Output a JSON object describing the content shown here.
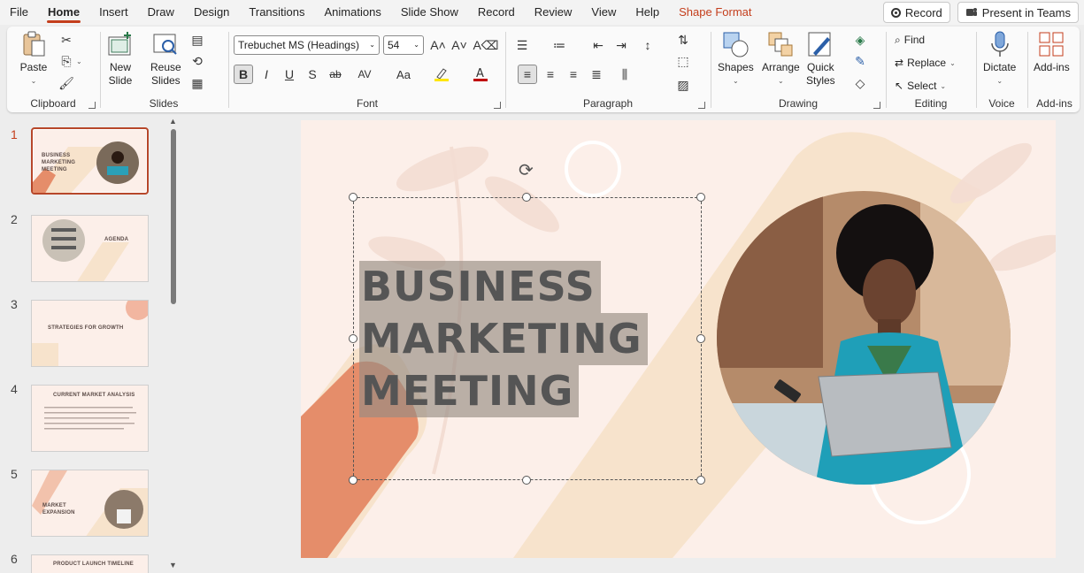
{
  "menu": {
    "items": [
      "File",
      "Home",
      "Insert",
      "Draw",
      "Design",
      "Transitions",
      "Animations",
      "Slide Show",
      "Record",
      "Review",
      "View",
      "Help",
      "Shape Format"
    ],
    "active": "Home",
    "record_label": "Record",
    "present_label": "Present in Teams"
  },
  "ribbon": {
    "clipboard": {
      "paste": "Paste",
      "label": "Clipboard"
    },
    "slides": {
      "new_slide_1": "New",
      "new_slide_2": "Slide",
      "reuse_1": "Reuse",
      "reuse_2": "Slides",
      "label": "Slides"
    },
    "font": {
      "font_name": "Trebuchet MS (Headings)",
      "font_size": "54",
      "bold": "B",
      "italic": "I",
      "underline": "U",
      "shadow": "S",
      "strike": "ab",
      "spacing": "AV",
      "case": "Aa",
      "label": "Font"
    },
    "paragraph": {
      "label": "Paragraph"
    },
    "drawing": {
      "shapes": "Shapes",
      "arrange": "Arrange",
      "quick_1": "Quick",
      "quick_2": "Styles",
      "label": "Drawing"
    },
    "editing": {
      "find": "Find",
      "replace": "Replace",
      "select": "Select",
      "label": "Editing"
    },
    "voice": {
      "dictate": "Dictate",
      "label": "Voice"
    },
    "addins": {
      "addins": "Add-ins",
      "label": "Add-ins"
    }
  },
  "thumbnails": [
    {
      "num": "1",
      "title": "BUSINESS MARKETING MEETING"
    },
    {
      "num": "2",
      "title": "AGENDA"
    },
    {
      "num": "3",
      "title": "STRATEGIES FOR GROWTH"
    },
    {
      "num": "4",
      "title": "CURRENT MARKET ANALYSIS"
    },
    {
      "num": "5",
      "title": "MARKET EXPANSION"
    },
    {
      "num": "6",
      "title": "PRODUCT LAUNCH TIMELINE"
    }
  ],
  "slide": {
    "title_lines": [
      "BUSINESS",
      "MARKETING",
      "MEETING"
    ]
  },
  "colors": {
    "accent": "#c43e1c",
    "slide_bg": "#fcefe9",
    "peach": "#f7e3cc",
    "terracotta": "#e58d6a"
  }
}
